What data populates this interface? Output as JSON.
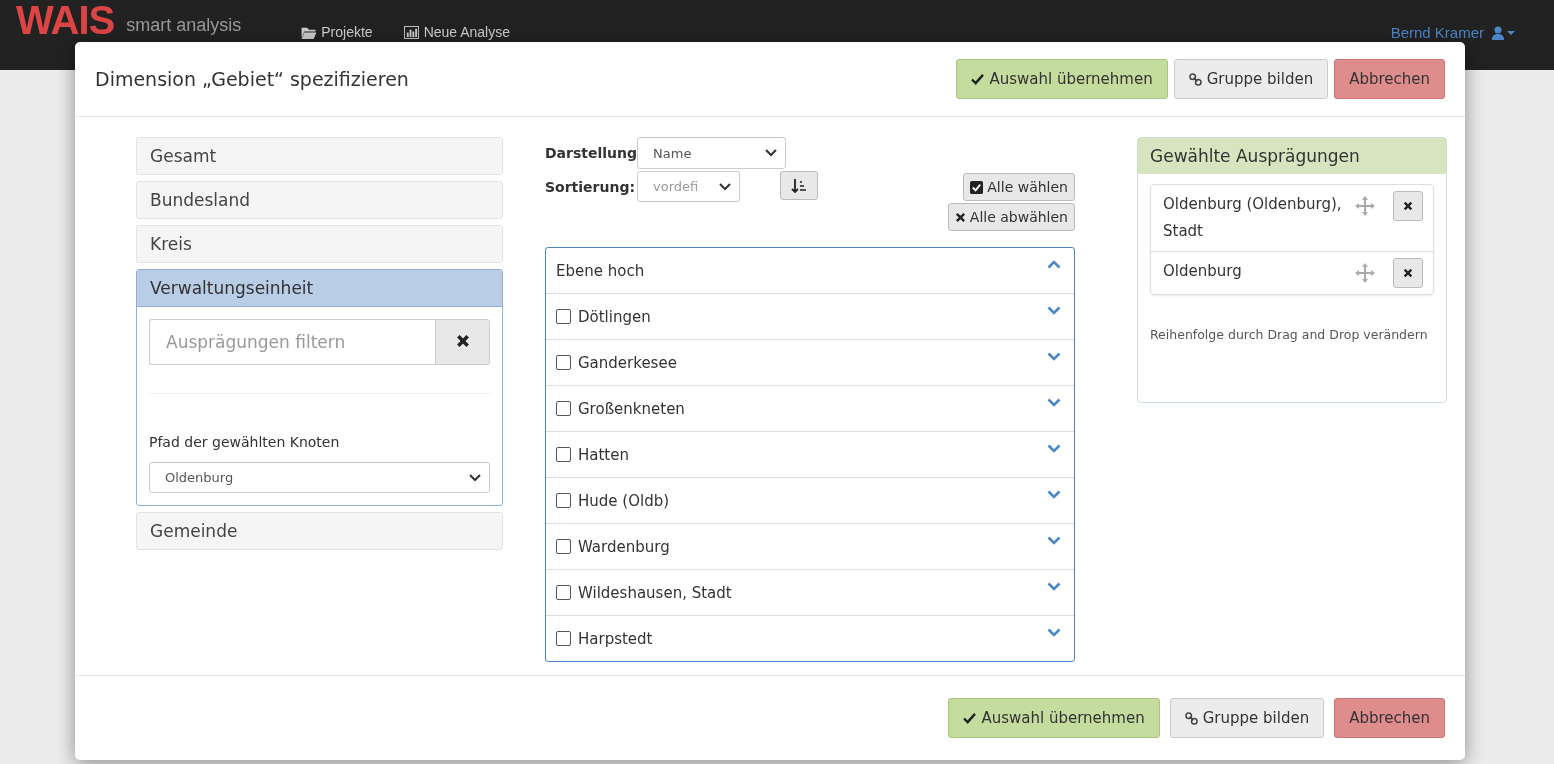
{
  "navbar": {
    "brand": "WAIS",
    "tagline": "smart analysis",
    "links": [
      {
        "label": "Projekte",
        "kind": "folder"
      },
      {
        "label": "Neue Analyse",
        "kind": "chart"
      }
    ],
    "user": "Bernd Kramer"
  },
  "dialog": {
    "title": "Dimension „Gebiet“ spezifizieren",
    "header_buttons": [
      {
        "label": "Auswahl übernehmen",
        "kind": "confirm"
      },
      {
        "label": "Gruppe bilden",
        "kind": "group"
      },
      {
        "label": "Abbrechen",
        "kind": "cancel"
      }
    ],
    "levels": [
      {
        "label": "Gesamt",
        "selected": false
      },
      {
        "label": "Bundesland",
        "selected": false
      },
      {
        "label": "Kreis",
        "selected": false
      },
      {
        "label": "Verwaltungseinheit",
        "selected": true
      },
      {
        "label": "Gemeinde",
        "selected": false
      }
    ],
    "filter": {
      "placeholder": "Ausprägungen filtern"
    },
    "path": {
      "label": "Pfad der gewählten Knoten",
      "value": "Oldenburg"
    },
    "display": {
      "label": "Darstellung",
      "value": "Name"
    },
    "sorting": {
      "label": "Sortierung:",
      "value": "vordefi"
    },
    "select_all": "Alle wählen",
    "deselect_all": "Alle abwählen",
    "list": {
      "up": "Ebene hoch",
      "items": [
        {
          "label": "Dötlingen",
          "checked": false
        },
        {
          "label": "Ganderkesee",
          "checked": false
        },
        {
          "label": "Großenkneten",
          "checked": false
        },
        {
          "label": "Hatten",
          "checked": false
        },
        {
          "label": "Hude (Oldb)",
          "checked": false
        },
        {
          "label": "Wardenburg",
          "checked": false
        },
        {
          "label": "Wildeshausen, Stadt",
          "checked": false
        },
        {
          "label": "Harpstedt",
          "checked": false
        }
      ]
    },
    "chosen": {
      "title": "Gewählte Ausprägungen",
      "items": [
        "Oldenburg (Oldenburg), Stadt",
        "Oldenburg"
      ],
      "hint": "Reihenfolge durch Drag and Drop verändern"
    },
    "footer_buttons": [
      {
        "label": "Auswahl übernehmen",
        "kind": "confirm"
      },
      {
        "label": "Gruppe bilden",
        "kind": "group"
      },
      {
        "label": "Abbrechen",
        "kind": "cancel"
      }
    ]
  }
}
